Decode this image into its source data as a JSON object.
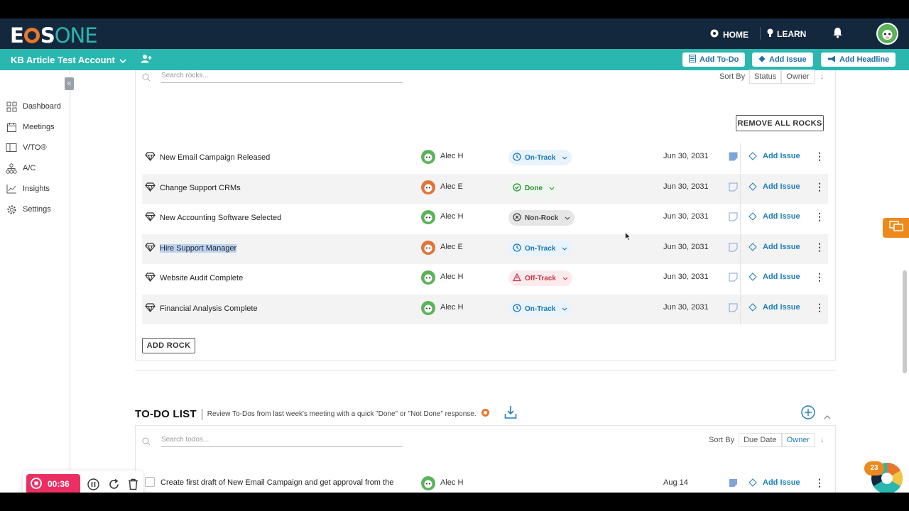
{
  "nav": {
    "logo_eos": "E",
    "logo_s": "S",
    "logo_one": "ONE",
    "home": "HOME",
    "learn": "LEARN"
  },
  "subbar": {
    "account": "KB Article Test Account",
    "add_todo": "Add To-Do",
    "add_issue": "Add Issue",
    "add_headline": "Add Headline"
  },
  "sidebar": {
    "items": [
      {
        "label": "Dashboard",
        "icon": "grid-icon"
      },
      {
        "label": "Meetings",
        "icon": "calendar-icon"
      },
      {
        "label": "V/TO®",
        "icon": "vto-icon"
      },
      {
        "label": "A/C",
        "icon": "org-chart-icon"
      },
      {
        "label": "Insights",
        "icon": "line-chart-icon"
      },
      {
        "label": "Settings",
        "icon": "gear-icon"
      }
    ]
  },
  "rocks": {
    "search_placeholder": "Search rocks...",
    "sort_by": "Sort By",
    "sort_status": "Status",
    "sort_owner": "Owner",
    "remove_all": "REMOVE ALL ROCKS",
    "add_rock": "ADD ROCK",
    "add_issue_label": "Add Issue",
    "rows": [
      {
        "title": "New Email Campaign Released",
        "owner": "Alec H",
        "status": "On-Track",
        "status_kind": "on",
        "date": "Jun 30, 2031",
        "note_filled": true
      },
      {
        "title": "Change Support CRMs",
        "owner": "Alec E",
        "status": "Done",
        "status_kind": "done",
        "date": "Jun 30, 2031",
        "note_filled": false
      },
      {
        "title": "New Accounting Software Selected",
        "owner": "Alec H",
        "status": "Non-Rock",
        "status_kind": "non",
        "date": "Jun 30, 2031",
        "note_filled": false
      },
      {
        "title": "Hire Support Manager",
        "owner": "Alec E",
        "status": "On-Track",
        "status_kind": "on",
        "date": "Jun 30, 2031",
        "note_filled": false
      },
      {
        "title": "Website Audit Complete",
        "owner": "Alec H",
        "status": "Off-Track",
        "status_kind": "off",
        "date": "Jun 30, 2031",
        "note_filled": false
      },
      {
        "title": "Financial Analysis Complete",
        "owner": "Alec H",
        "status": "On-Track",
        "status_kind": "on",
        "date": "Jun 30, 2031",
        "note_filled": false
      }
    ]
  },
  "todo": {
    "heading": "TO-DO LIST",
    "description": "Review To-Dos from last week's meeting with a quick \"Done\" or \"Not Done\" response.",
    "search_placeholder": "Search todos...",
    "sort_by": "Sort By",
    "sort_due": "Due Date",
    "sort_owner": "Owner",
    "first_item": "Create first draft of New Email Campaign and get approval from the",
    "first_owner": "Alec H",
    "first_date": "Aug 14",
    "add_issue_label": "Add Issue"
  },
  "recorder": {
    "time": "00:36"
  },
  "widget": {
    "count": "23"
  },
  "colors": {
    "nav_bg": "#13283d",
    "teal": "#2ab7b0",
    "orange": "#ee8a1d",
    "link_blue": "#1e7fb8",
    "record_red": "#ec2f62"
  }
}
